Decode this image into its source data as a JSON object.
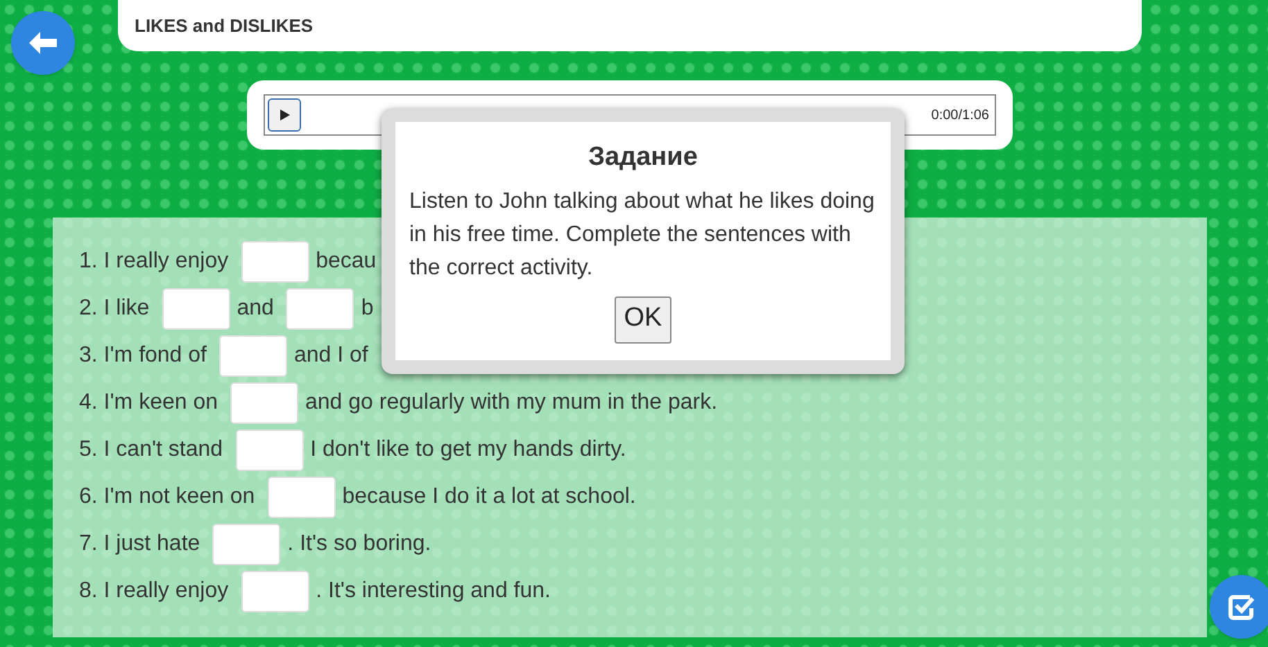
{
  "header": {
    "title": "LIKES and DISLIKES"
  },
  "audio_player": {
    "time": "0:00/1:06"
  },
  "exercise": {
    "items": [
      {
        "parts": [
          {
            "kind": "text",
            "text": "1. I really enjoy"
          },
          {
            "kind": "blank"
          },
          {
            "kind": "text",
            "text": "becau"
          }
        ]
      },
      {
        "parts": [
          {
            "kind": "text",
            "text": "2. I like"
          },
          {
            "kind": "blank"
          },
          {
            "kind": "text",
            "text": "and"
          },
          {
            "kind": "blank"
          },
          {
            "kind": "text",
            "text": "b"
          }
        ]
      },
      {
        "parts": [
          {
            "kind": "text",
            "text": "3. I'm fond of"
          },
          {
            "kind": "blank"
          },
          {
            "kind": "text",
            "text": "and I of"
          }
        ]
      },
      {
        "parts": [
          {
            "kind": "text",
            "text": "4. I'm keen on"
          },
          {
            "kind": "blank"
          },
          {
            "kind": "text",
            "text": "and go regularly with my mum in the park."
          }
        ]
      },
      {
        "parts": [
          {
            "kind": "text",
            "text": "5. I can't stand"
          },
          {
            "kind": "blank"
          },
          {
            "kind": "text",
            "text": "I don't like to get my hands dirty."
          }
        ]
      },
      {
        "parts": [
          {
            "kind": "text",
            "text": "6. I'm not keen on"
          },
          {
            "kind": "blank"
          },
          {
            "kind": "text",
            "text": "because I do it a lot at school."
          }
        ]
      },
      {
        "parts": [
          {
            "kind": "text",
            "text": "7. I just hate"
          },
          {
            "kind": "blank"
          },
          {
            "kind": "tail",
            "text": ". It's so boring."
          }
        ]
      },
      {
        "parts": [
          {
            "kind": "text",
            "text": "8. I really enjoy"
          },
          {
            "kind": "blank"
          },
          {
            "kind": "tail",
            "text": ". It's interesting and fun."
          }
        ]
      }
    ]
  },
  "dialog": {
    "title": "Задание",
    "message": "Listen to John talking about what he likes doing in his free time. Complete the sentences with the correct activity.",
    "button": "OK"
  }
}
